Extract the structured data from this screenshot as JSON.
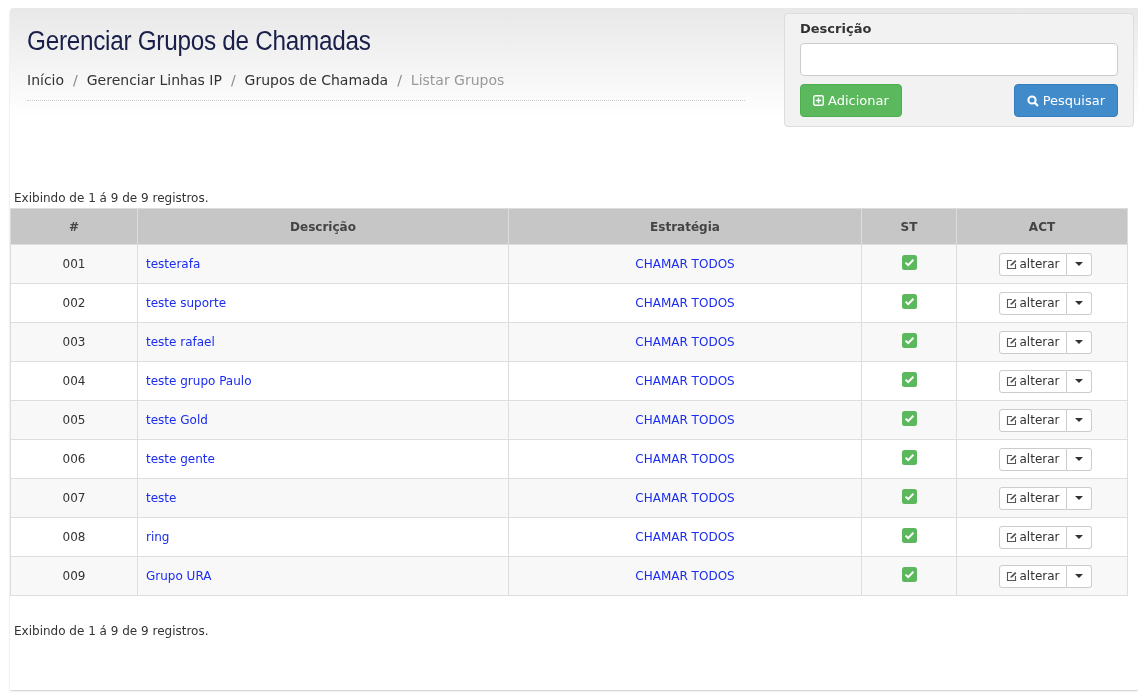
{
  "header": {
    "title": "Gerenciar Grupos de Chamadas",
    "breadcrumb": [
      {
        "label": "Início",
        "current": false
      },
      {
        "label": "Gerenciar Linhas IP",
        "current": false
      },
      {
        "label": "Grupos de Chamada",
        "current": false
      },
      {
        "label": "Listar Grupos",
        "current": true
      }
    ],
    "breadcrumb_separator": "/"
  },
  "search": {
    "label": "Descrição",
    "add_button": "Adicionar",
    "search_button": "Pesquisar"
  },
  "summary_top": "Exibindo de 1 á 9 de 9 registros.",
  "table": {
    "columns": [
      "#",
      "Descrição",
      "Estratégia",
      "ST",
      "ACT"
    ],
    "rows": [
      {
        "id": "001",
        "description": "testerafa",
        "strategy": "CHAMAR TODOS",
        "checked": true,
        "action": "alterar"
      },
      {
        "id": "002",
        "description": "teste suporte",
        "strategy": "CHAMAR TODOS",
        "checked": true,
        "action": "alterar"
      },
      {
        "id": "003",
        "description": "teste rafael",
        "strategy": "CHAMAR TODOS",
        "checked": true,
        "action": "alterar"
      },
      {
        "id": "004",
        "description": "teste grupo Paulo",
        "strategy": "CHAMAR TODOS",
        "checked": true,
        "action": "alterar"
      },
      {
        "id": "005",
        "description": "teste Gold",
        "strategy": "CHAMAR TODOS",
        "checked": true,
        "action": "alterar"
      },
      {
        "id": "006",
        "description": "teste gente",
        "strategy": "CHAMAR TODOS",
        "checked": true,
        "action": "alterar"
      },
      {
        "id": "007",
        "description": "teste",
        "strategy": "CHAMAR TODOS",
        "checked": true,
        "action": "alterar"
      },
      {
        "id": "008",
        "description": "ring",
        "strategy": "CHAMAR TODOS",
        "checked": true,
        "action": "alterar"
      },
      {
        "id": "009",
        "description": "Grupo URA",
        "strategy": "CHAMAR TODOS",
        "checked": true,
        "action": "alterar"
      }
    ]
  },
  "summary_bottom": "Exibindo de 1 á 9 de 9 registros."
}
